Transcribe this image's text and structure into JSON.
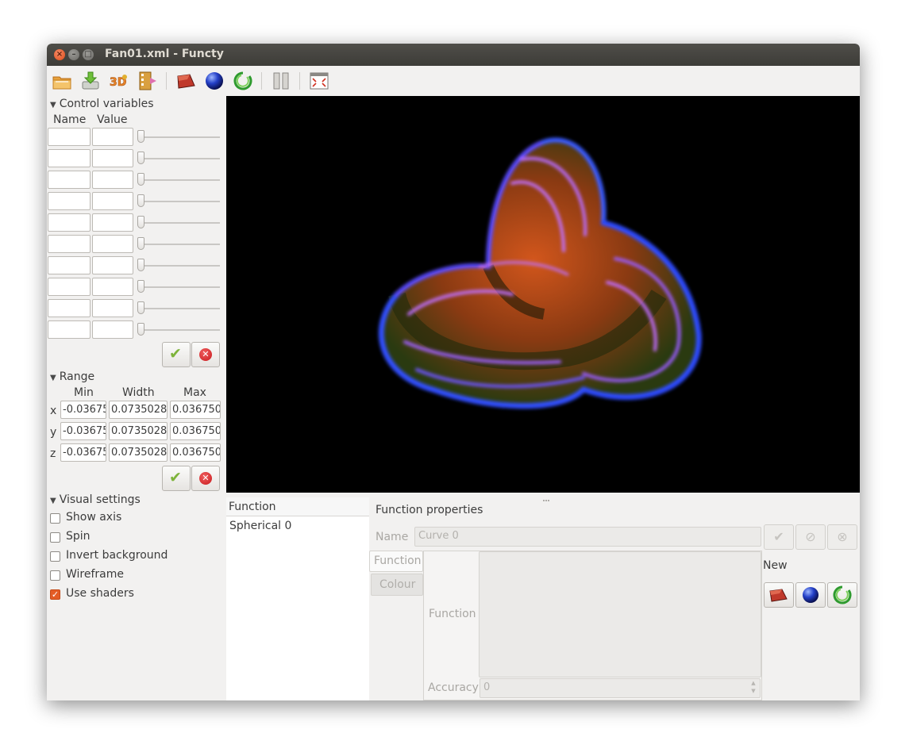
{
  "window": {
    "title": "Fan01.xml - Functy"
  },
  "toolbar": {
    "items": [
      "open-folder-icon",
      "save-icon",
      "export-3d-icon",
      "export-video-icon",
      "new-cartesian-icon",
      "new-spherical-icon",
      "new-curve-icon",
      "pause-icon",
      "fullscreen-icon"
    ]
  },
  "control_variables": {
    "title": "Control variables",
    "headers": {
      "name": "Name",
      "value": "Value"
    },
    "rows": 10
  },
  "range": {
    "title": "Range",
    "headers": {
      "min": "Min",
      "width": "Width",
      "max": "Max"
    },
    "axes": [
      {
        "label": "x",
        "min": "-0.03675",
        "width": "0.0735028",
        "max": "0.036750"
      },
      {
        "label": "y",
        "min": "-0.03675",
        "width": "0.0735028",
        "max": "0.036750"
      },
      {
        "label": "z",
        "min": "-0.03675",
        "width": "0.0735028",
        "max": "0.036750"
      }
    ]
  },
  "visual_settings": {
    "title": "Visual settings",
    "options": [
      {
        "label": "Show axis",
        "checked": false
      },
      {
        "label": "Spin",
        "checked": false
      },
      {
        "label": "Invert background",
        "checked": false
      },
      {
        "label": "Wireframe",
        "checked": false
      },
      {
        "label": "Use shaders",
        "checked": true
      }
    ]
  },
  "function_list": {
    "header": "Function",
    "items": [
      "Spherical 0"
    ]
  },
  "function_properties": {
    "title": "Function properties",
    "name_label": "Name",
    "name_value": "Curve 0",
    "tabs": [
      "Function",
      "Colour"
    ],
    "function_label": "Function",
    "accuracy_label": "Accuracy",
    "accuracy_value": "0",
    "new_label": "New"
  },
  "colors": {
    "title_bar": "#3d3c38",
    "accent_orange": "#e45c25",
    "ok_green": "#7db33a",
    "cancel_red": "#c8181c"
  }
}
